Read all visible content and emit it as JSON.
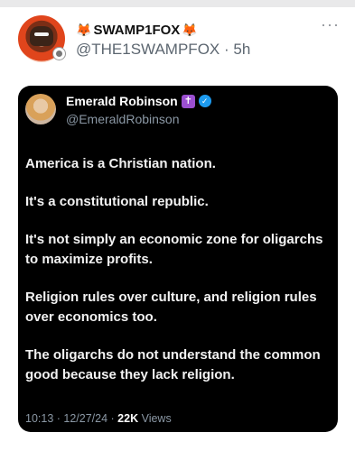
{
  "post": {
    "display_name": "SWAMP1FOX",
    "handle": "@THE1SWAMPFOX",
    "separator": "·",
    "time": "5h",
    "more": "···",
    "emoji_left": "🦊",
    "emoji_right": "🦊"
  },
  "quote": {
    "display_name": "Emerald Robinson",
    "handle": "@EmeraldRobinson",
    "badge_cross": "✝",
    "badge_check": "✓",
    "paragraphs": [
      "America is a Christian nation.",
      "It's a constitutional republic.",
      "It's not simply an economic zone for oligarchs to maximize profits.",
      "Religion rules over culture, and religion rules over economics too.",
      "The oligarchs do not understand the common good because they lack religion."
    ],
    "timestamp": "10:13 · 12/27/24 ·",
    "views_count": "22K",
    "views_label": "Views"
  }
}
